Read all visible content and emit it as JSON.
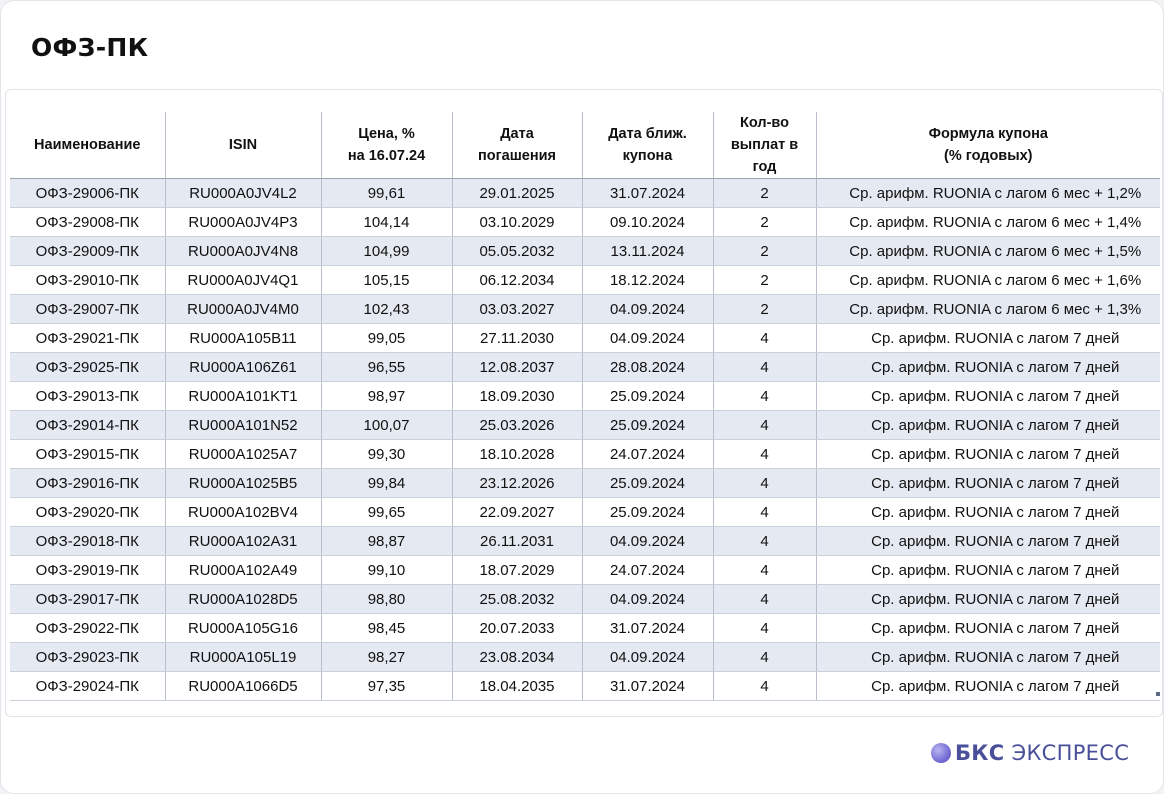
{
  "title": "ОФЗ-ПК",
  "columns": [
    "Наименование",
    "ISIN",
    "Цена, %\nна 16.07.24",
    "Дата\nпогашения",
    "Дата ближ.\nкупона",
    "Кол-во\nвыплат в\nгод",
    "Формула купона\n(% годовых)"
  ],
  "rows": [
    [
      "ОФЗ-29006-ПК",
      "RU000A0JV4L2",
      "99,61",
      "29.01.2025",
      "31.07.2024",
      "2",
      "Ср. арифм. RUONIA с лагом 6 мес + 1,2%"
    ],
    [
      "ОФЗ-29008-ПК",
      "RU000A0JV4P3",
      "104,14",
      "03.10.2029",
      "09.10.2024",
      "2",
      "Ср. арифм. RUONIA с лагом 6 мес + 1,4%"
    ],
    [
      "ОФЗ-29009-ПК",
      "RU000A0JV4N8",
      "104,99",
      "05.05.2032",
      "13.11.2024",
      "2",
      "Ср. арифм. RUONIA с лагом 6 мес + 1,5%"
    ],
    [
      "ОФЗ-29010-ПК",
      "RU000A0JV4Q1",
      "105,15",
      "06.12.2034",
      "18.12.2024",
      "2",
      "Ср. арифм. RUONIA с лагом 6 мес + 1,6%"
    ],
    [
      "ОФЗ-29007-ПК",
      "RU000A0JV4M0",
      "102,43",
      "03.03.2027",
      "04.09.2024",
      "2",
      "Ср. арифм. RUONIA с лагом 6 мес + 1,3%"
    ],
    [
      "ОФЗ-29021-ПК",
      "RU000A105B11",
      "99,05",
      "27.11.2030",
      "04.09.2024",
      "4",
      "Ср. арифм. RUONIA с лагом 7 дней"
    ],
    [
      "ОФЗ-29025-ПК",
      "RU000A106Z61",
      "96,55",
      "12.08.2037",
      "28.08.2024",
      "4",
      "Ср. арифм. RUONIA с лагом 7 дней"
    ],
    [
      "ОФЗ-29013-ПК",
      "RU000A101KT1",
      "98,97",
      "18.09.2030",
      "25.09.2024",
      "4",
      "Ср. арифм. RUONIA с лагом 7 дней"
    ],
    [
      "ОФЗ-29014-ПК",
      "RU000A101N52",
      "100,07",
      "25.03.2026",
      "25.09.2024",
      "4",
      "Ср. арифм. RUONIA с лагом 7 дней"
    ],
    [
      "ОФЗ-29015-ПК",
      "RU000A1025A7",
      "99,30",
      "18.10.2028",
      "24.07.2024",
      "4",
      "Ср. арифм. RUONIA с лагом 7 дней"
    ],
    [
      "ОФЗ-29016-ПК",
      "RU000A1025B5",
      "99,84",
      "23.12.2026",
      "25.09.2024",
      "4",
      "Ср. арифм. RUONIA с лагом 7 дней"
    ],
    [
      "ОФЗ-29020-ПК",
      "RU000A102BV4",
      "99,65",
      "22.09.2027",
      "25.09.2024",
      "4",
      "Ср. арифм. RUONIA с лагом 7 дней"
    ],
    [
      "ОФЗ-29018-ПК",
      "RU000A102A31",
      "98,87",
      "26.11.2031",
      "04.09.2024",
      "4",
      "Ср. арифм. RUONIA с лагом 7 дней"
    ],
    [
      "ОФЗ-29019-ПК",
      "RU000A102A49",
      "99,10",
      "18.07.2029",
      "24.07.2024",
      "4",
      "Ср. арифм. RUONIA с лагом 7 дней"
    ],
    [
      "ОФЗ-29017-ПК",
      "RU000A1028D5",
      "98,80",
      "25.08.2032",
      "04.09.2024",
      "4",
      "Ср. арифм. RUONIA с лагом 7 дней"
    ],
    [
      "ОФЗ-29022-ПК",
      "RU000A105G16",
      "98,45",
      "20.07.2033",
      "31.07.2024",
      "4",
      "Ср. арифм. RUONIA с лагом 7 дней"
    ],
    [
      "ОФЗ-29023-ПК",
      "RU000A105L19",
      "98,27",
      "23.08.2034",
      "04.09.2024",
      "4",
      "Ср. арифм. RUONIA с лагом 7 дней"
    ],
    [
      "ОФЗ-29024-ПК",
      "RU000A1066D5",
      "97,35",
      "18.04.2035",
      "31.07.2024",
      "4",
      "Ср. арифм. RUONIA с лагом 7 дней"
    ]
  ],
  "logo": {
    "bold": "БКС",
    "rest": "ЭКСПРЕСС",
    "icon": "bks-sphere-icon"
  },
  "colors": {
    "row_stripe": "#e5eaf2",
    "logo": "#4a4f9a"
  }
}
